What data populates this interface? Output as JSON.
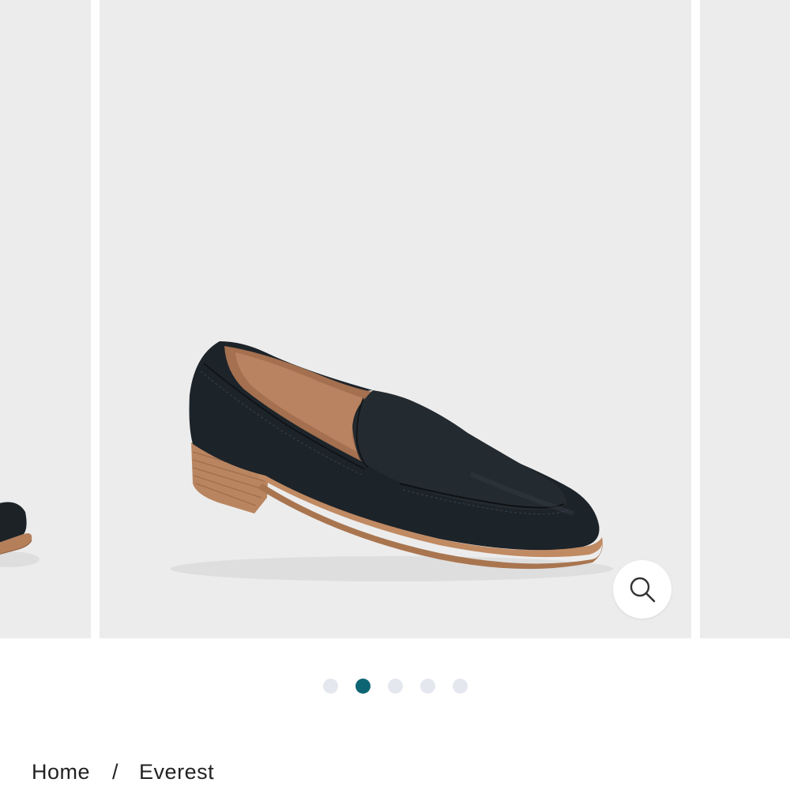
{
  "carousel": {
    "images": [
      {
        "name": "loafer-side-view"
      },
      {
        "name": "loafer-three-quarter-view"
      },
      {
        "name": "loafer-alternate-view"
      }
    ],
    "zoom_icon": "search-icon",
    "indicators": [
      {
        "active": false
      },
      {
        "active": true
      },
      {
        "active": false
      },
      {
        "active": false
      },
      {
        "active": false
      }
    ]
  },
  "breadcrumb": {
    "home_label": "Home",
    "separator": "/",
    "current_label": "Everest"
  },
  "colors": {
    "image_background": "#ececec",
    "active_dot": "#0d6473",
    "inactive_dot": "#e4e8ee",
    "text": "#222222"
  }
}
